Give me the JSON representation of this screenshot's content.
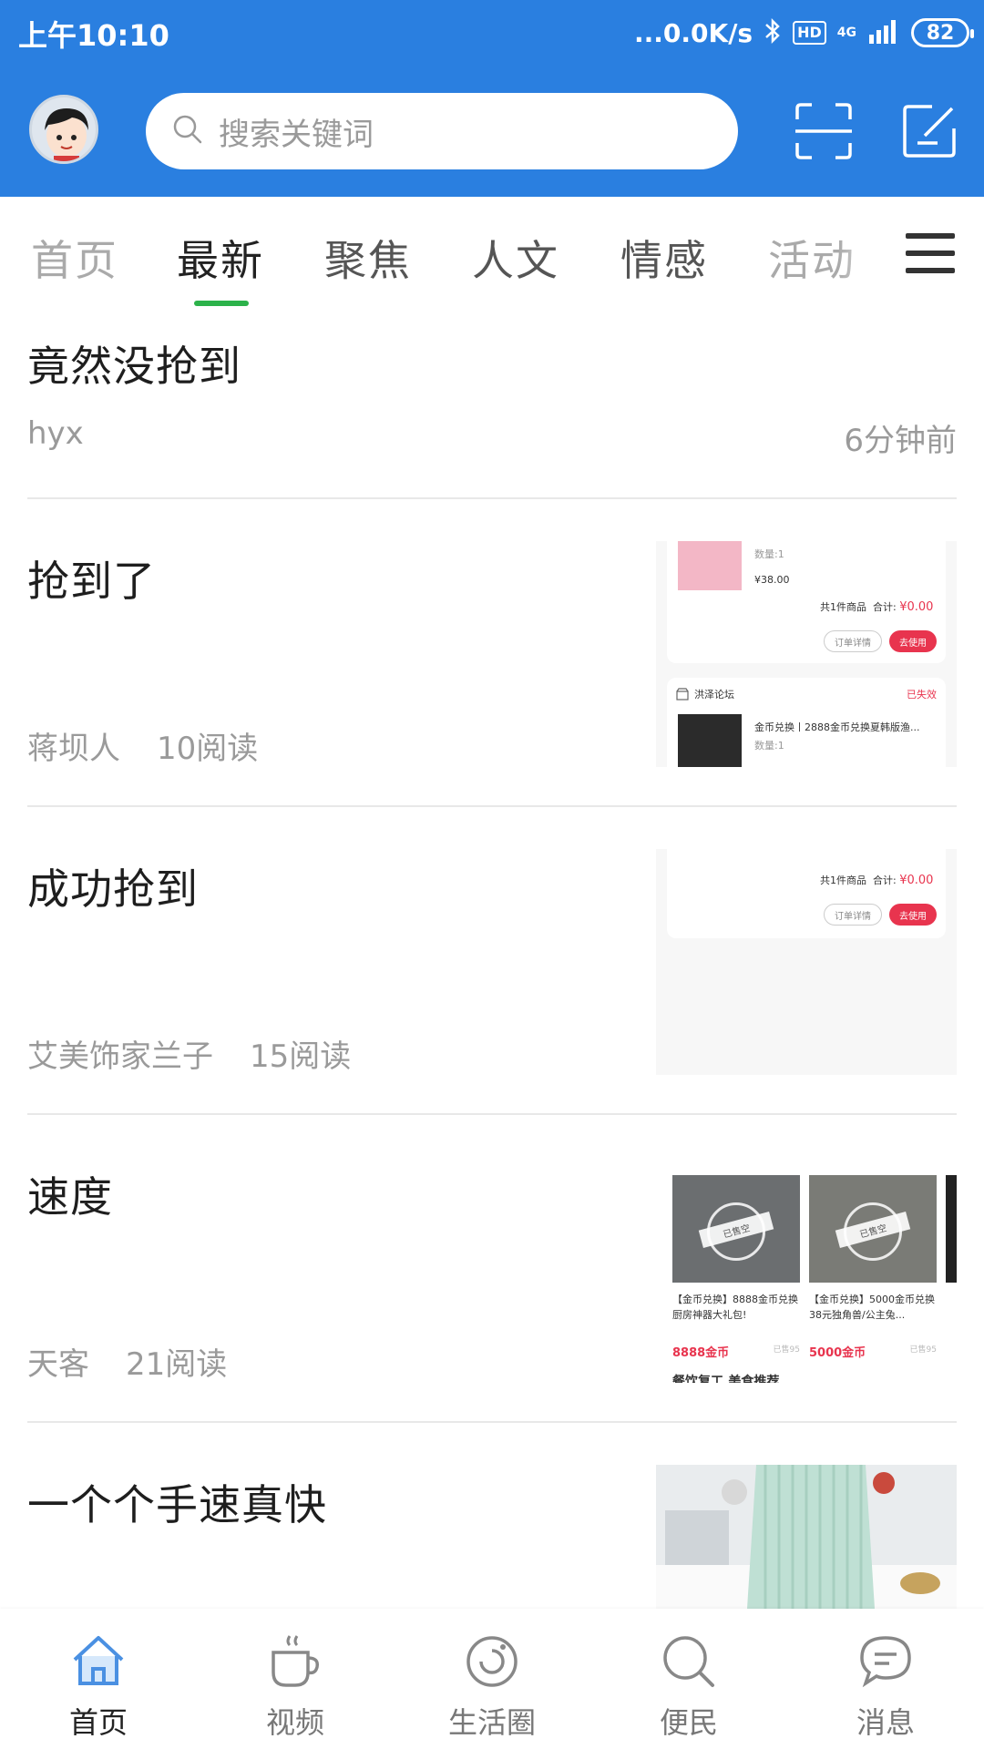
{
  "status_bar": {
    "time": "上午10:10",
    "net_speed": "...0.0K/s",
    "hd": "HD",
    "network": "4G",
    "battery": "82"
  },
  "header": {
    "search_placeholder": "搜索关键词",
    "accent_color": "#2a7fe0"
  },
  "tabs": [
    {
      "label": "首页"
    },
    {
      "label": "最新"
    },
    {
      "label": "聚焦"
    },
    {
      "label": "人文"
    },
    {
      "label": "情感"
    },
    {
      "label": "活动"
    }
  ],
  "active_tab": "最新",
  "feed": [
    {
      "title": "竟然没抢到",
      "author": "hyx",
      "time": "6分钟前"
    },
    {
      "title": "抢到了",
      "author": "蒋坝人",
      "reads": "10阅读"
    },
    {
      "title": "成功抢到",
      "author": "艾美饰家兰子",
      "reads": "15阅读"
    },
    {
      "title": "速度",
      "author": "天客",
      "reads": "21阅读"
    },
    {
      "title": "一个个手速真快"
    }
  ],
  "thumb_order": {
    "qty": "数量:1",
    "price": "¥38.00",
    "summary": "共1件商品",
    "total_label": "合计:",
    "total": "¥0.00",
    "detail_btn": "订单详情",
    "use_btn": "去使用",
    "shop": "洪泽论坛",
    "status": "已失效",
    "product": "金币兑换丨2888金币兑换夏韩版渔...",
    "qty2": "数量:1"
  },
  "thumb_order2": {
    "summary": "共1件商品",
    "total_label": "合计:",
    "total": "¥0.00",
    "detail_btn": "订单详情",
    "use_btn": "去使用"
  },
  "thumb_shop": {
    "items": [
      {
        "name": "【金币兑换】8888金币兑换厨房神器大礼包!",
        "price": "8888金币",
        "sold": "已售95",
        "stamp": "已售空"
      },
      {
        "name": "【金币兑换】5000金币兑换38元独角兽/公主兔...",
        "price": "5000金币",
        "sold": "已售95",
        "stamp": "已售空"
      }
    ],
    "footer": "餐饮复工,美食推荐"
  },
  "bottom_nav": [
    {
      "label": "首页",
      "icon": "home-icon"
    },
    {
      "label": "视频",
      "icon": "coffee-cup-icon"
    },
    {
      "label": "生活圈",
      "icon": "circle-icon"
    },
    {
      "label": "便民",
      "icon": "search-icon"
    },
    {
      "label": "消息",
      "icon": "chat-bubble-icon"
    }
  ]
}
